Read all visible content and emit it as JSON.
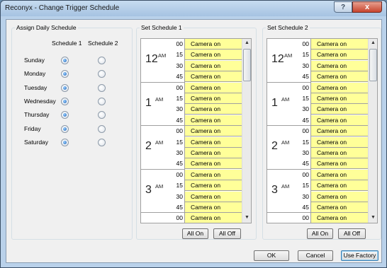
{
  "window": {
    "title": "Reconyx - Change Trigger Schedule",
    "help_glyph": "?",
    "close_glyph": "x"
  },
  "daily": {
    "legend": "Assign Daily Schedule",
    "col1": "Schedule 1",
    "col2": "Schedule 2",
    "days": [
      {
        "label": "Sunday",
        "schedule": 1
      },
      {
        "label": "Monday",
        "schedule": 1
      },
      {
        "label": "Tuesday",
        "schedule": 1
      },
      {
        "label": "Wednesday",
        "schedule": 1
      },
      {
        "label": "Thursday",
        "schedule": 1
      },
      {
        "label": "Friday",
        "schedule": 1
      },
      {
        "label": "Saturday",
        "schedule": 1
      }
    ]
  },
  "schedules": [
    {
      "legend": "Set Schedule 1",
      "hours": [
        {
          "hour": "12",
          "ampm": "AM"
        },
        {
          "hour": "1",
          "ampm": "AM"
        },
        {
          "hour": "2",
          "ampm": "AM"
        },
        {
          "hour": "3",
          "ampm": "AM"
        }
      ],
      "minutes": [
        "00",
        "15",
        "30",
        "45"
      ],
      "extra_minute": "00",
      "cell_text": "Camera on",
      "all_on": "All On",
      "all_off": "All Off"
    },
    {
      "legend": "Set Schedule 2",
      "hours": [
        {
          "hour": "12",
          "ampm": "AM"
        },
        {
          "hour": "1",
          "ampm": "AM"
        },
        {
          "hour": "2",
          "ampm": "AM"
        },
        {
          "hour": "3",
          "ampm": "AM"
        }
      ],
      "minutes": [
        "00",
        "15",
        "30",
        "45"
      ],
      "extra_minute": "00",
      "cell_text": "Camera on",
      "all_on": "All On",
      "all_off": "All Off"
    }
  ],
  "buttons": {
    "ok": "OK",
    "cancel": "Cancel",
    "use_factory": "Use Factory"
  },
  "scroll": {
    "up": "▲",
    "down": "▼"
  }
}
